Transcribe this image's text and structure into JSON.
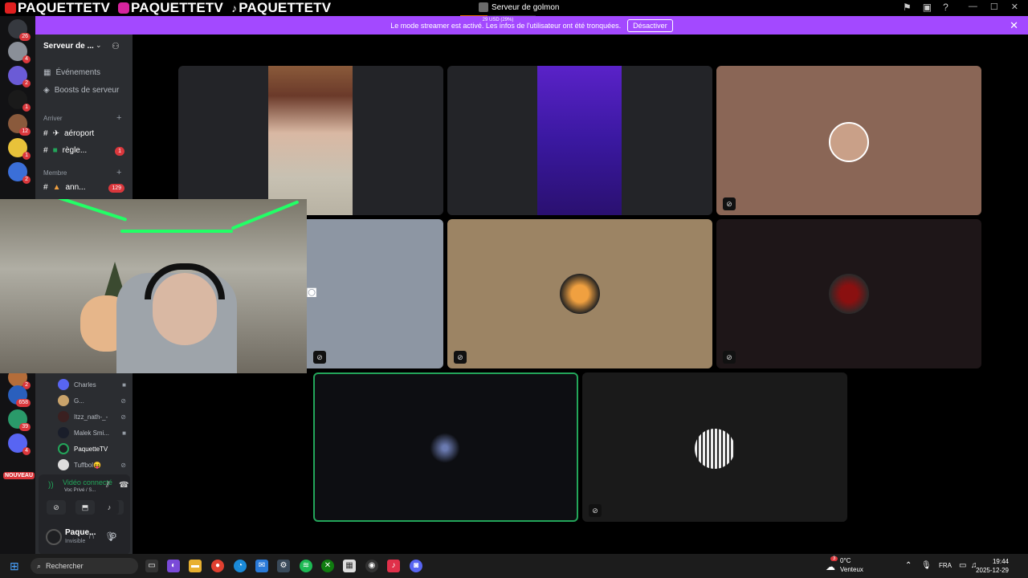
{
  "brand": {
    "youtube_handle": "PAQUETTETV",
    "instagram_handle": "PAQUETTETV",
    "tiktok_handle": "PAQUETTETV"
  },
  "window": {
    "title": "Serveur de golmon",
    "subtitle": "S'APPELLE MON EX"
  },
  "price_overlay": "29 USD (29%)",
  "banner": {
    "text": "Le mode streamer est activé. Les infos de l'utilisateur ont été tronquées.",
    "button_label": "Désactiver"
  },
  "servers": {
    "badges": [
      "26",
      "4",
      "2",
      "1",
      "12",
      "1",
      "2",
      "2",
      "658",
      "39",
      "4"
    ],
    "new_label": "NOUVEAU"
  },
  "sidebar": {
    "server_name": "Serveur de ...",
    "events_label": "Événements",
    "boosts_label": "Boosts de serveur",
    "category_arrival": "Arriver",
    "category_member": "Membre",
    "channels": [
      {
        "name": "aéroport",
        "badge": ""
      },
      {
        "name": "règle...",
        "badge": "1"
      },
      {
        "name": "ann...",
        "badge": "129"
      }
    ],
    "voice_users": [
      {
        "name": "Charles",
        "icon": "camera-icon"
      },
      {
        "name": "G...",
        "icon": "mute-icon"
      },
      {
        "name": "Itzz_nath-_-",
        "icon": "mute-icon"
      },
      {
        "name": "Malek Smi...",
        "icon": "camera-icon"
      },
      {
        "name": "PaquetteTV",
        "icon": ""
      },
      {
        "name": "Tuffbol😝",
        "icon": "mute-icon"
      }
    ]
  },
  "voice_panel": {
    "status": "Vidéo connecté",
    "channel": "Voc Privé / S..."
  },
  "user_panel": {
    "name": "Paque...",
    "status": "Invisible"
  },
  "taskbar": {
    "search_placeholder": "Rechercher",
    "weather_temp": "0°C",
    "weather_desc": "Venteux",
    "weather_badge": "3",
    "language": "FRA",
    "time": "19:44",
    "date": "2025-12-29"
  },
  "colors": {
    "banner": "#a349ff",
    "sidebar": "#2b2d31",
    "server_rail": "#121214",
    "connected_green": "#23a55a",
    "tile_bg": "#232428"
  }
}
